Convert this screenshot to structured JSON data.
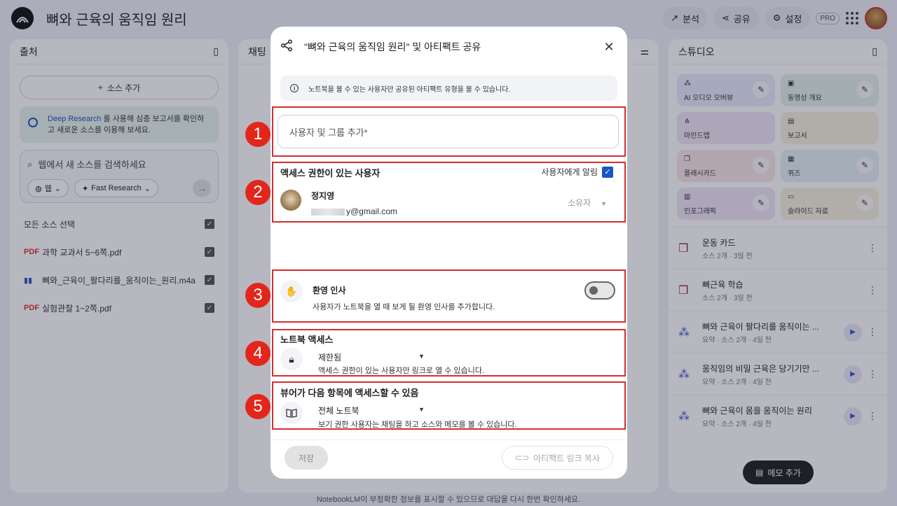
{
  "app": {
    "title": "뼈와 근육의 움직임 원리",
    "actions": {
      "analysis": "분석",
      "share": "공유",
      "settings": "설정",
      "pro": "PRO"
    }
  },
  "sources_panel": {
    "title": "출처",
    "add_source": "소스 추가",
    "deep_research_link": "Deep Research",
    "deep_research_text": " 를 사용해 심층 보고서를 확인하고 새로운 소스를 이용해 보세요.",
    "search_placeholder": "웹에서 새 소스를 검색하세요",
    "chip_web": "웹",
    "chip_fast": "Fast Research",
    "select_all": "모든 소스 선택",
    "sources": [
      {
        "label": "과학 교과서 5~6쪽.pdf",
        "type": "PDF"
      },
      {
        "label": "뼈와_근육이_팔다리를_움직이는_원리.m4a",
        "type": "audio"
      },
      {
        "label": "실험관찰 1~2쪽.pdf",
        "type": "PDF"
      }
    ]
  },
  "chat_panel": {
    "title": "채팅"
  },
  "studio_panel": {
    "title": "스튜디오",
    "tiles": [
      {
        "label": "AI 오디오 오버뷰",
        "color": "#e8ecfa"
      },
      {
        "label": "동영상 개요",
        "color": "#e4f1e6"
      },
      {
        "label": "마인드맵",
        "color": "#efe6f3"
      },
      {
        "label": "보고서",
        "color": "#f7f2df"
      },
      {
        "label": "플래시카드",
        "color": "#f9e7e6"
      },
      {
        "label": "퀴즈",
        "color": "#e3f0f3"
      },
      {
        "label": "인포그래픽",
        "color": "#efe6f3"
      },
      {
        "label": "슬라이드 자료",
        "color": "#f7f2df"
      }
    ],
    "notes": [
      {
        "title": "운동 카드",
        "meta": "소스 2개 · 3일 전",
        "icon": "flashcard-icon"
      },
      {
        "title": "뼈근육 학습",
        "meta": "소스 2개 · 3일 전",
        "icon": "flashcard-icon"
      },
      {
        "title": "뼈와 근육이 팔다리를 움직이는 ...",
        "meta": "요약 · 소스 2개 · 4일 전",
        "icon": "audio-icon"
      },
      {
        "title": "움직임의 비밀 근육은 당기기만 ...",
        "meta": "요약 · 소스 2개 · 4일 전",
        "icon": "audio-icon"
      },
      {
        "title": "뼈와 근육이 몸을 움직이는 원리",
        "meta": "요약 · 소스 2개 · 4일 전",
        "icon": "audio-icon"
      }
    ],
    "add_memo": "메모 추가"
  },
  "footer_note": "NotebookLM이 부정확한 정보를 표시할 수 있으므로 대답을 다시 한번 확인하세요.",
  "dialog": {
    "title": "\"뼈와 근육의 움직임 원리\" 및 아티팩트 공유",
    "info": "노트북을 볼 수 있는 사용자만 공유된 아티팩트 유형을 볼 수 있습니다.",
    "add_people_placeholder": "사용자 및 그룹 추가*",
    "access_title": "액세스 권한이 있는 사용자",
    "notify_label": "사용자에게 알림",
    "user": {
      "name": "정지영",
      "email_suffix": "y@gmail.com",
      "role": "소유자"
    },
    "welcome": {
      "title": "환영 인사",
      "desc": "사용자가 노트북을 열 때 보게 될 환영 인사를 추가합니다.",
      "enabled": false
    },
    "notebook_access": {
      "title": "노트북 액세스",
      "value": "제한됨",
      "desc": "액세스 권한이 있는 사용자만 링크로 열 수 있습니다."
    },
    "viewer_access": {
      "title": "뷰어가 다음 항목에 액세스할 수 있음",
      "value": "전체 노트북",
      "desc": "보기 권한 사용자는 채팅을 하고 소스와 메모를 볼 수 있습니다."
    },
    "save": "저장",
    "copy_link": "아티팩트 링크 복사"
  },
  "badges": [
    "1",
    "2",
    "3",
    "4",
    "5"
  ],
  "colors": {
    "accent": "#1a56c4",
    "highlight": "#d32f2f",
    "badge": "#e3261b"
  }
}
